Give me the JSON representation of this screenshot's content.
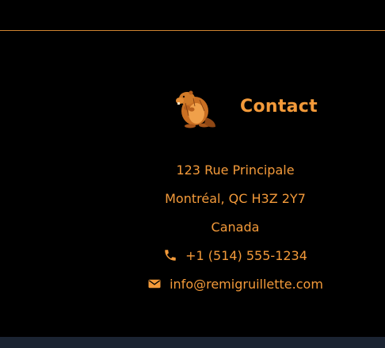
{
  "footer": {
    "contact_title": "Contact",
    "logo_icon": "beaver-logo",
    "address": {
      "street": "123 Rue Principale",
      "city_line": "Montréal, QC H3Z 2Y7",
      "country": "Canada"
    },
    "phone": {
      "icon": "phone-icon",
      "number": "+1 (514) 555-1234"
    },
    "email": {
      "icon": "envelope-icon",
      "address": "info@remigruillette.com"
    }
  },
  "colors": {
    "accent": "#f39a3a",
    "background": "#000000",
    "bottom_bar": "#1b2432"
  }
}
